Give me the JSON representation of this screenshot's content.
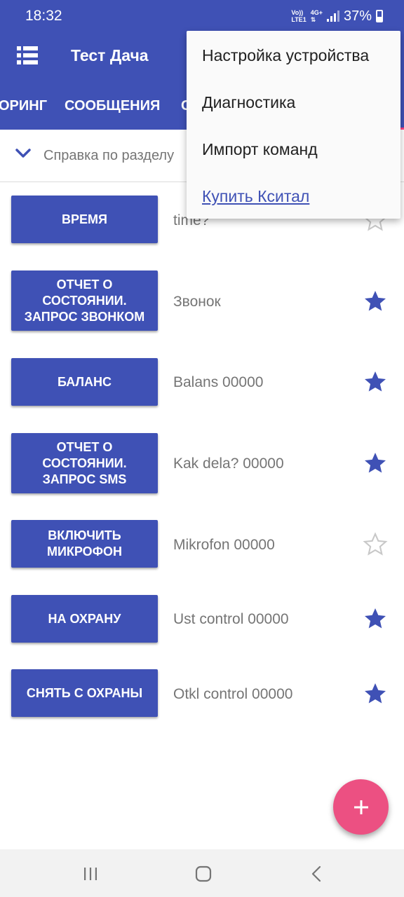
{
  "status_bar": {
    "time": "18:32",
    "network_top": "Vo))",
    "network_bottom": "LTE1",
    "network_type": "4G+",
    "battery": "37%"
  },
  "app_bar": {
    "title": "Тест Дача",
    "menu_icon": "list-menu-icon"
  },
  "tabs": [
    {
      "label": "ОРИНГ"
    },
    {
      "label": "СООБЩЕНИЯ"
    },
    {
      "label": "С"
    }
  ],
  "help": {
    "label": "Справка по разделу",
    "icon": "chevron-down-icon"
  },
  "popup_menu": {
    "items": [
      {
        "label": "Настройка устройства"
      },
      {
        "label": "Диагностика"
      },
      {
        "label": "Импорт команд"
      },
      {
        "label": "Купить Кситал",
        "link": true
      }
    ]
  },
  "commands": [
    {
      "button": "ВРЕМЯ",
      "text": "time?",
      "favorite": false
    },
    {
      "button": "ОТЧЕТ О СОСТОЯНИИ. ЗАПРОС ЗВОНКОМ",
      "text": "Звонок",
      "favorite": true
    },
    {
      "button": "БАЛАНС",
      "text": "Balans 00000",
      "favorite": true
    },
    {
      "button": "ОТЧЕТ О СОСТОЯНИИ. ЗАПРОС SMS",
      "text": "Kak dela? 00000",
      "favorite": true
    },
    {
      "button": "ВКЛЮЧИТЬ МИКРОФОН",
      "text": "Mikrofon 00000",
      "favorite": false
    },
    {
      "button": "НА ОХРАНУ",
      "text": "Ust control 00000",
      "favorite": true
    },
    {
      "button": "СНЯТЬ С ОХРАНЫ",
      "text": "Otkl control 00000",
      "favorite": true
    }
  ],
  "fab": {
    "icon": "plus-icon"
  },
  "nav_bar": {
    "icons": [
      "recents-icon",
      "home-icon",
      "back-icon"
    ]
  },
  "colors": {
    "primary": "#3f51b5",
    "fab": "#ec5082",
    "star_filled": "#3f51b5",
    "star_empty": "#c8c8c8"
  }
}
